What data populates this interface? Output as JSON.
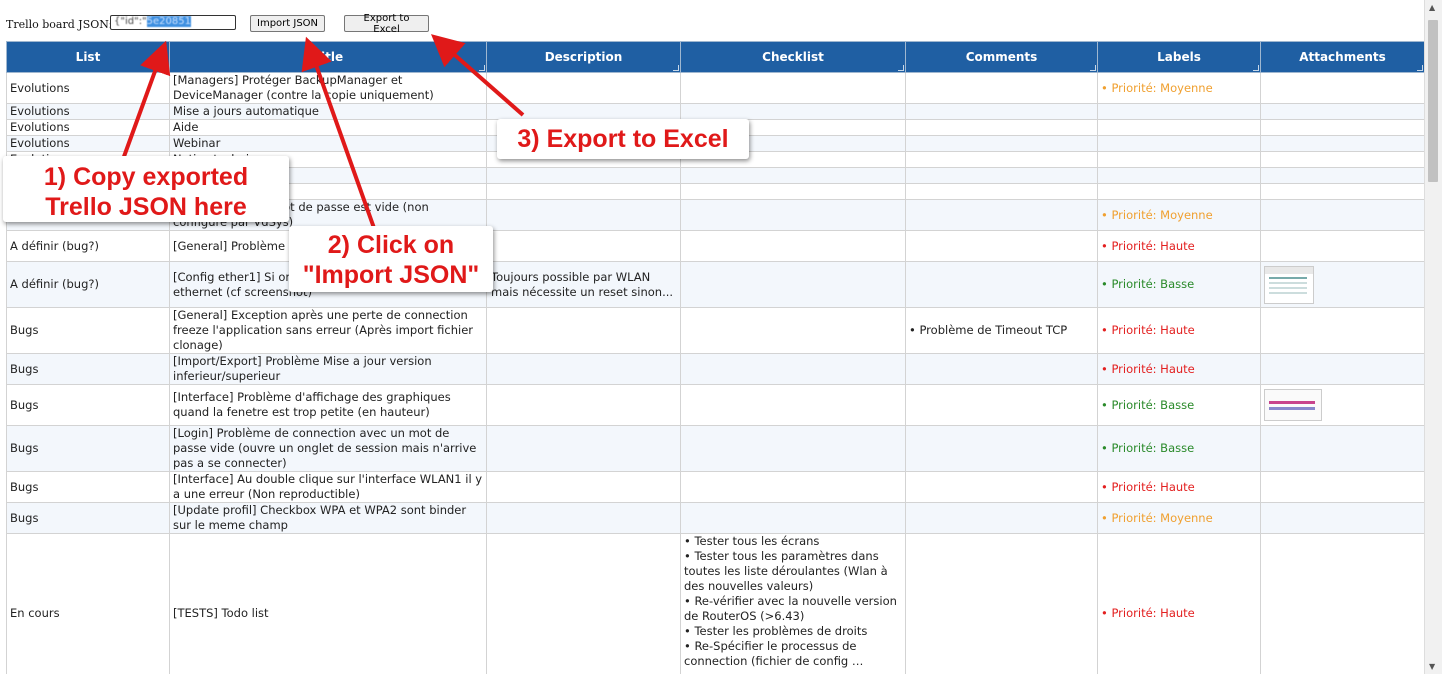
{
  "toolbar": {
    "json_label": "Trello board JSON:",
    "json_value_prefix": "{\"id\":\"",
    "json_value_selected": "5e20851",
    "import_label": "Import JSON",
    "export_label": "Export to Excel"
  },
  "table": {
    "headers": [
      "List",
      "Title",
      "Description",
      "Checklist",
      "Comments",
      "Labels",
      "Attachments"
    ],
    "rows": [
      {
        "list": "Evolutions",
        "title": "[Managers] Protéger BackupManager et DeviceManager (contre la copie uniquement)",
        "description": "",
        "checklist": [],
        "comments": "",
        "label": "Priorité: Moyenne",
        "label_color": "orange",
        "attachment": ""
      },
      {
        "list": "Evolutions",
        "title": "Mise a jours automatique",
        "description": "",
        "checklist": [],
        "comments": "",
        "label": "",
        "label_color": "",
        "attachment": ""
      },
      {
        "list": "Evolutions",
        "title": "Aide",
        "description": "",
        "checklist": [],
        "comments": "",
        "label": "",
        "label_color": "",
        "attachment": ""
      },
      {
        "list": "Evolutions",
        "title": "Webinar",
        "description": "",
        "checklist": [],
        "comments": "",
        "label": "",
        "label_color": "",
        "attachment": ""
      },
      {
        "list": "Evolutions",
        "title": "Notice technique",
        "description": "",
        "checklist": [],
        "comments": "",
        "label": "",
        "label_color": "",
        "attachment": ""
      },
      {
        "list": "",
        "title": "",
        "description": "",
        "checklist": [],
        "comments": "",
        "label": "",
        "label_color": "",
        "attachment": ""
      },
      {
        "list": "",
        "title": "",
        "description": "",
        "checklist": [],
        "comments": "",
        "label": "",
        "label_color": "",
        "attachment": ""
      },
      {
        "list": "",
        "title": "…port lorsque le mot de passe est vide (non configuré par VdSys)",
        "description": "",
        "checklist": [],
        "comments": "",
        "label": "Priorité: Moyenne",
        "label_color": "orange",
        "attachment": ""
      },
      {
        "list": "A définir (bug?)",
        "title": "[General] Problème … les adresses IPv6",
        "description": "",
        "checklist": [],
        "comments": "",
        "label": "Priorité: Haute",
        "label_color": "red",
        "attachment": ""
      },
      {
        "list": "A définir (bug?)",
        "title": "[Config ether1] Si on … négociation ether1 … ethernet (cf screenshot)",
        "description": "Toujours possible par WLAN mais nécessite un reset sinon...",
        "checklist": [],
        "comments": "",
        "label": "Priorité: Basse",
        "label_color": "green",
        "attachment": "thumb"
      },
      {
        "list": "Bugs",
        "title": "[General] Exception après une perte de connection freeze l'application sans erreur (Après import fichier clonage)",
        "description": "",
        "checklist": [],
        "comments": "Problème de Timeout TCP",
        "label": "Priorité: Haute",
        "label_color": "red",
        "attachment": ""
      },
      {
        "list": "Bugs",
        "title": "[Import/Export] Problème Mise a jour version inferieur/superieur",
        "description": "",
        "checklist": [],
        "comments": "",
        "label": "Priorité: Haute",
        "label_color": "red",
        "attachment": ""
      },
      {
        "list": "Bugs",
        "title": "[Interface] Problème d'affichage des graphiques quand la fenetre est trop petite (en hauteur)",
        "description": "",
        "checklist": [],
        "comments": "",
        "label": "Priorité: Basse",
        "label_color": "green",
        "attachment": "thumb2"
      },
      {
        "list": "Bugs",
        "title": "[Login] Problème de connection avec un mot de passe vide (ouvre un onglet de session mais n'arrive pas a se connecter)",
        "description": "",
        "checklist": [],
        "comments": "",
        "label": "Priorité: Basse",
        "label_color": "green",
        "attachment": ""
      },
      {
        "list": "Bugs",
        "title": "[Interface] Au double clique sur l'interface WLAN1 il y a une erreur (Non reproductible)",
        "description": "",
        "checklist": [],
        "comments": "",
        "label": "Priorité: Haute",
        "label_color": "red",
        "attachment": ""
      },
      {
        "list": "Bugs",
        "title": "[Update profil] Checkbox WPA et WPA2 sont binder sur le meme champ",
        "description": "",
        "checklist": [],
        "comments": "",
        "label": "Priorité: Moyenne",
        "label_color": "orange",
        "attachment": ""
      },
      {
        "list": "En cours",
        "title": "[TESTS] Todo list",
        "description": "",
        "checklist": [
          "Tester tous les écrans",
          "Tester tous les paramètres dans toutes les liste déroulantes (Wlan à des nouvelles valeurs)",
          "Re-vérifier avec la nouvelle version de RouterOS (>6.43)",
          "Tester les problèmes de droits",
          "Re-Spécifier le processus de connection (fichier de config …"
        ],
        "comments": "",
        "label": "Priorité: Haute",
        "label_color": "red",
        "attachment": ""
      }
    ]
  },
  "callouts": {
    "step1": "1) Copy exported Trello JSON here",
    "step2": "2) Click on \"Import JSON\"",
    "step3": "3) Export to Excel"
  },
  "colors": {
    "header_bg": "#1f5fa3",
    "callout_text": "#e01919",
    "label_red": "#e32020",
    "label_orange": "#f0a030",
    "label_green": "#2a8a2a"
  }
}
